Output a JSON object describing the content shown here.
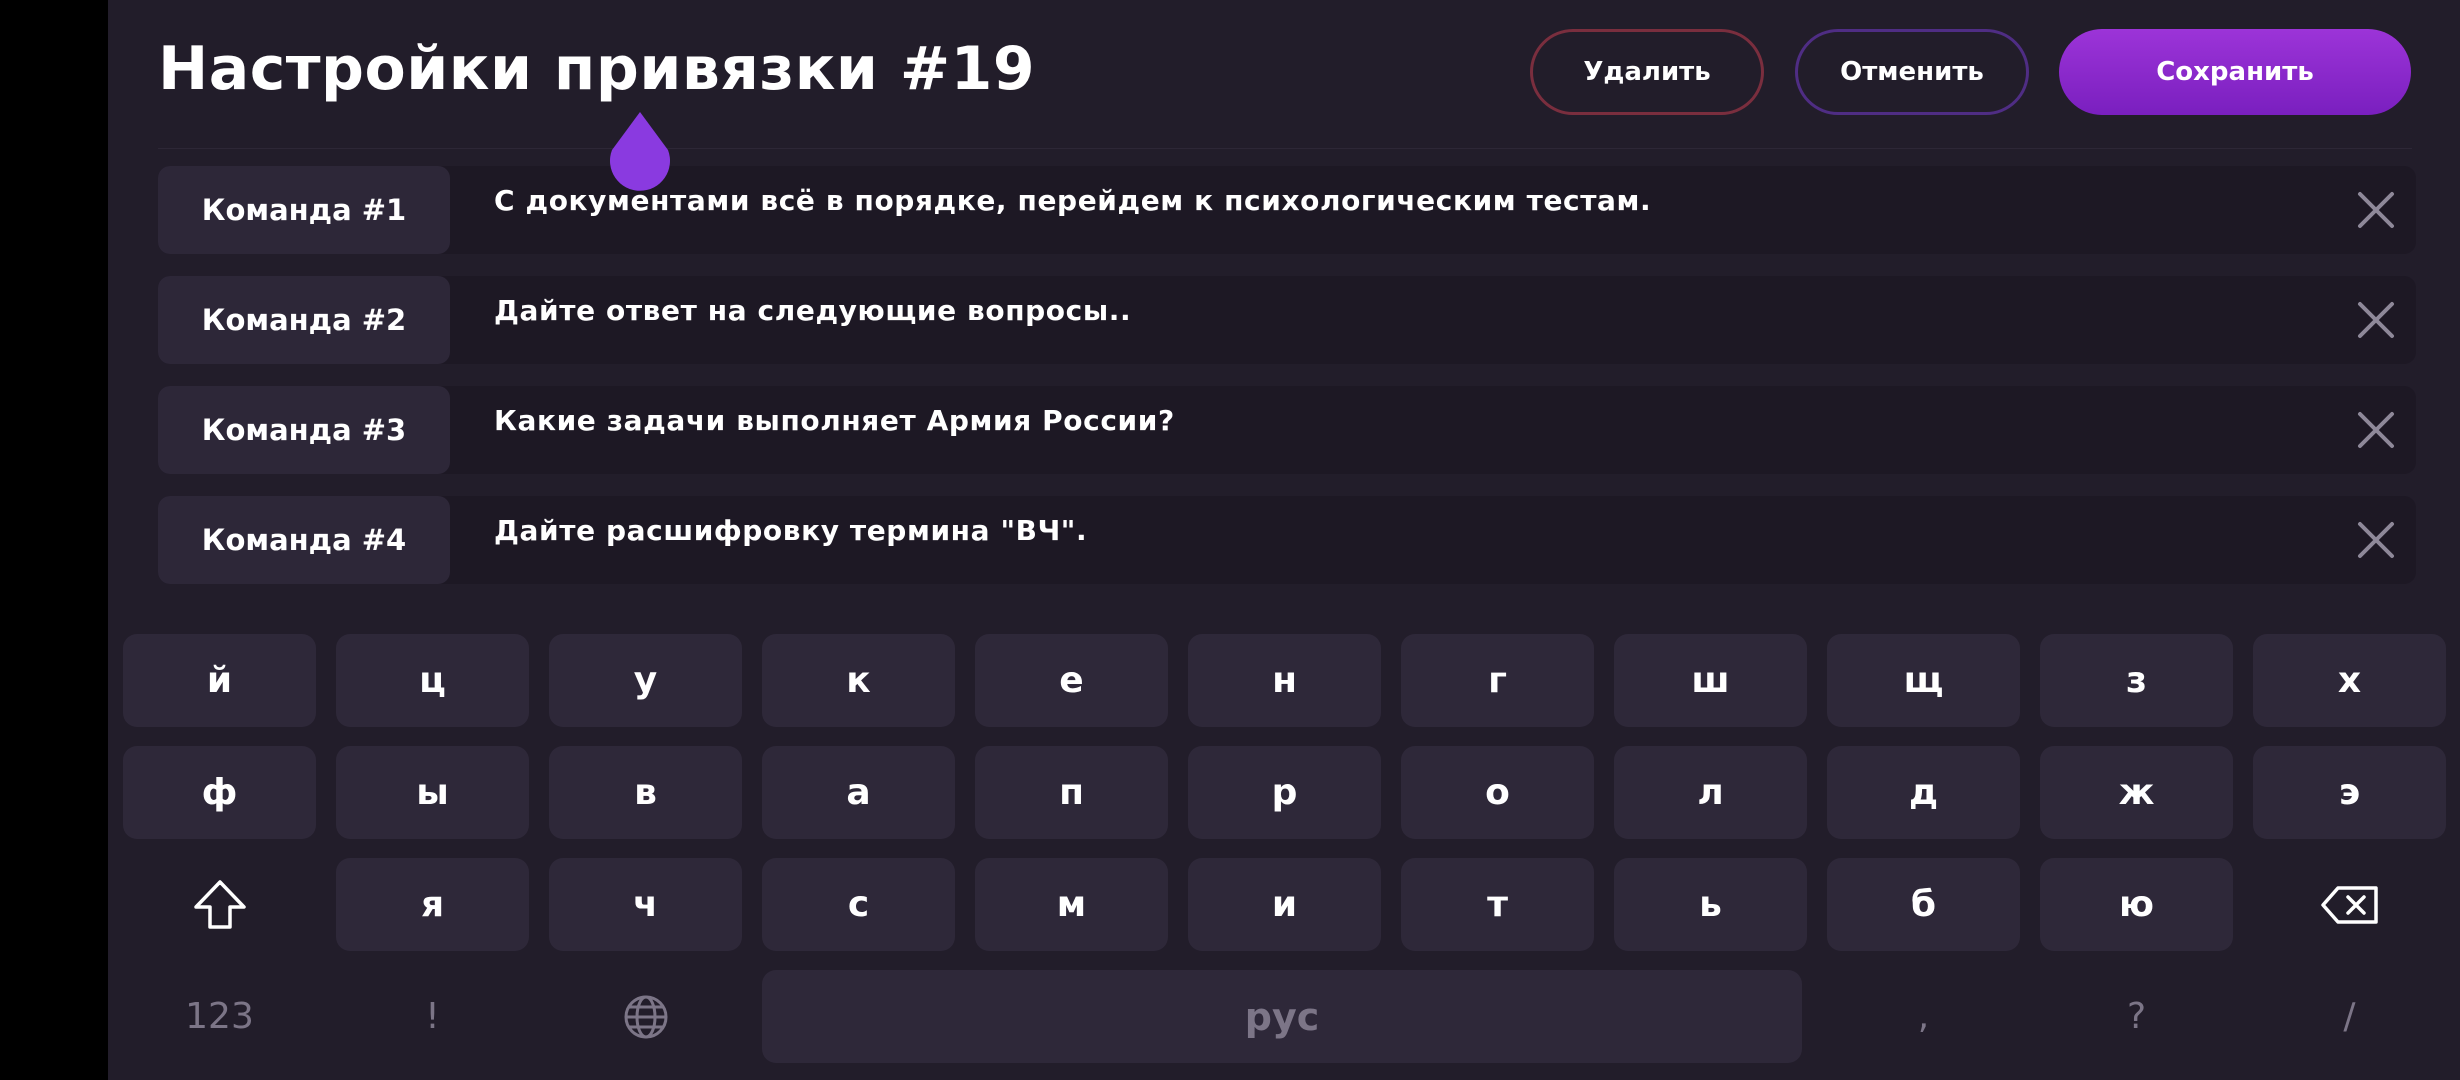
{
  "header": {
    "title": "Настройки привязки #19",
    "delete_label": "Удалить",
    "cancel_label": "Отменить",
    "save_label": "Сохранить"
  },
  "commands": [
    {
      "label": "Команда #1",
      "text": "С документами всё в порядке, перейдем к психологическим тестам."
    },
    {
      "label": "Команда #2",
      "text": "Дайте ответ на следующие вопросы.."
    },
    {
      "label": "Команда #3",
      "text": "Какие задачи выполняет Армия России?"
    },
    {
      "label": "Команда #4",
      "text": "Дайте расшифровку термина \"ВЧ\"."
    }
  ],
  "keyboard": {
    "row1": [
      "й",
      "ц",
      "у",
      "к",
      "е",
      "н",
      "г",
      "ш",
      "щ",
      "з",
      "х"
    ],
    "row2": [
      "ф",
      "ы",
      "в",
      "а",
      "п",
      "р",
      "о",
      "л",
      "д",
      "ж",
      "э"
    ],
    "row3": [
      "я",
      "ч",
      "с",
      "м",
      "и",
      "т",
      "ь",
      "б",
      "ю"
    ],
    "numbers_label": "123",
    "exclaim": "!",
    "space_label": "рус",
    "comma": ",",
    "question": "?",
    "slash": "/",
    "icons": {
      "shift": "shift-icon",
      "backspace": "backspace-icon",
      "globe": "globe-icon"
    }
  },
  "colors": {
    "accent": "#8a2be2",
    "delete_border": "#7a2e3e",
    "cancel_border": "#4f2d84",
    "background": "#221d2a"
  }
}
